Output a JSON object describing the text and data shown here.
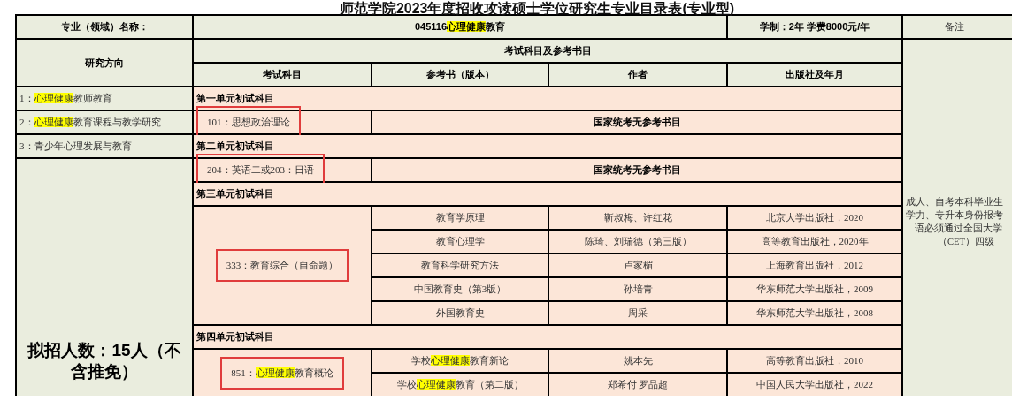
{
  "title": "师范学院2023年度招收攻读硕士学位研究生专业目录表(专业型)",
  "major": {
    "label": "专业（领域）名称：",
    "name": [
      {
        "text": "045116",
        "highlighted": false
      },
      {
        "text": "心理健康",
        "highlighted": true
      },
      {
        "text": "教育",
        "highlighted": false
      }
    ],
    "duration_fee": "学制：2年 学费8000元/年"
  },
  "remarks_header": "备注",
  "direction_header": "研究方向",
  "exam_header": "考试科目及参考书目",
  "columns": [
    "考试科目",
    "参考书（版本）",
    "作者",
    "出版社及年月"
  ],
  "directions": [
    {
      "parts": [
        {
          "text": "1：",
          "highlighted": false
        },
        {
          "text": "心理健康",
          "highlighted": true
        },
        {
          "text": "教师教育",
          "highlighted": false
        }
      ]
    },
    {
      "parts": [
        {
          "text": "2：",
          "highlighted": false
        },
        {
          "text": "心理健康",
          "highlighted": true
        },
        {
          "text": "教育课程与教学研究",
          "highlighted": false
        }
      ]
    },
    {
      "parts": [
        {
          "text": "3：青少年心理发展与教育",
          "highlighted": false
        }
      ]
    }
  ],
  "enrollment": "拟招人数：15人（不含推免）",
  "units": [
    {
      "title": "第一单元初试科目",
      "subject": {
        "annotated": true,
        "parts": [
          {
            "text": "101：思想政治理论",
            "highlighted": false
          }
        ]
      },
      "note": "国家统考无参考书目"
    },
    {
      "title": "第二单元初试科目",
      "subject": {
        "annotated": true,
        "parts": [
          {
            "text": "204：英语二或203：日语",
            "highlighted": false
          }
        ]
      },
      "note": "国家统考无参考书目"
    },
    {
      "title": "第三单元初试科目",
      "subject": {
        "annotated": true,
        "parts": [
          {
            "text": "333：教育综合（自命题）",
            "highlighted": false
          }
        ]
      },
      "books": [
        {
          "parts": [
            {
              "text": "教育学原理",
              "highlighted": false
            }
          ],
          "author": "靳叔梅、许红花",
          "publisher": "北京大学出版社，2020"
        },
        {
          "parts": [
            {
              "text": "教育心理学",
              "highlighted": false
            }
          ],
          "author": "陈琦、刘瑞德（第三版）",
          "publisher": "高等教育出版社，2020年"
        },
        {
          "parts": [
            {
              "text": "教育科学研究方法",
              "highlighted": false
            }
          ],
          "author": "卢家楣",
          "publisher": "上海教育出版社，2012"
        },
        {
          "parts": [
            {
              "text": "中国教育史（第3版）",
              "highlighted": false
            }
          ],
          "author": "孙培青",
          "publisher": "华东师范大学出版社，2009"
        },
        {
          "parts": [
            {
              "text": "外国教育史",
              "highlighted": false
            }
          ],
          "author": "周采",
          "publisher": "华东师范大学出版社，2008"
        }
      ]
    },
    {
      "title": "第四单元初试科目",
      "subject": {
        "annotated": true,
        "parts": [
          {
            "text": "851：",
            "highlighted": false
          },
          {
            "text": "心理健康",
            "highlighted": true
          },
          {
            "text": "教育概论",
            "highlighted": false
          }
        ]
      },
      "books": [
        {
          "parts": [
            {
              "text": "学校",
              "highlighted": false
            },
            {
              "text": "心理健康",
              "highlighted": true
            },
            {
              "text": "教育新论",
              "highlighted": false
            }
          ],
          "author": "姚本先",
          "publisher": "高等教育出版社，2010"
        },
        {
          "parts": [
            {
              "text": "学校",
              "highlighted": false
            },
            {
              "text": "心理健康",
              "highlighted": true
            },
            {
              "text": "教育（第二版）",
              "highlighted": false
            }
          ],
          "author": "郑希付 罗品超",
          "publisher": "中国人民大学出版社，2022"
        }
      ]
    }
  ],
  "remarks": [
    "成人、自考本科毕业生",
    "学力、专升本身份报考",
    "语必须通过全国大学",
    "（CET）四级"
  ]
}
